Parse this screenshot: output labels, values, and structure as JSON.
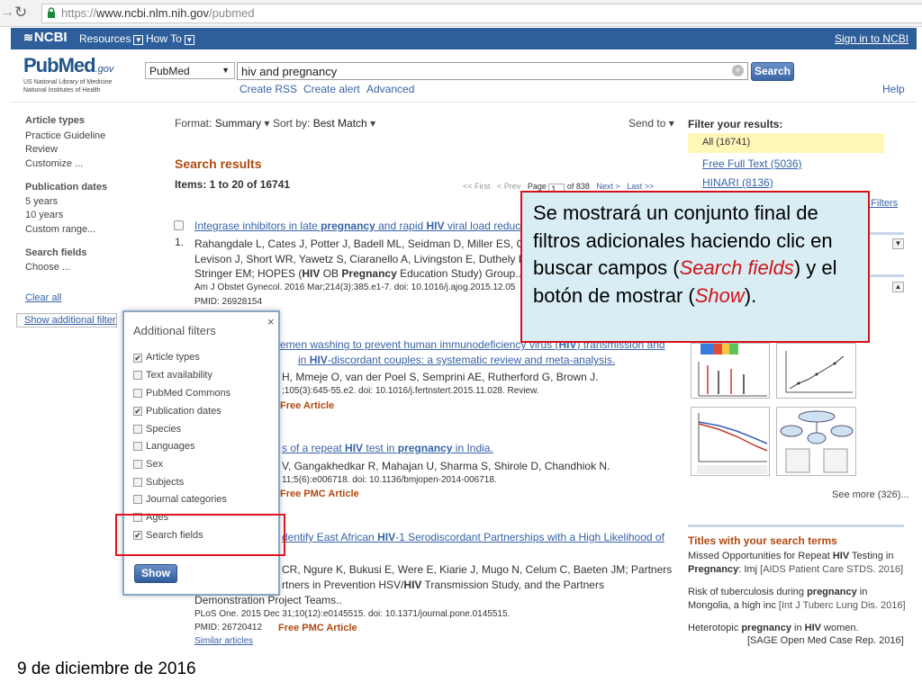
{
  "browser": {
    "url_scheme": "https://",
    "url_host": "www.ncbi.nlm.nih.gov",
    "url_path": "/pubmed"
  },
  "ncbi_bar": {
    "logo": "NCBI",
    "resources": "Resources",
    "howto": "How To",
    "signin": "Sign in to NCBI"
  },
  "header": {
    "logo_pub": "Pub",
    "logo_med": "Med",
    "logo_gov": ".gov",
    "nlm_line1": "US National Library of Medicine",
    "nlm_line2": "National Institutes of Health",
    "db_select": "PubMed",
    "search_value": "hiv and pregnancy",
    "search_button": "Search",
    "create_rss": "Create RSS",
    "create_alert": "Create alert",
    "advanced": "Advanced",
    "help": "Help"
  },
  "sidebar": {
    "article_types_head": "Article types",
    "article_types": [
      "Practice Guideline",
      "Review",
      "Customize ..."
    ],
    "pub_dates_head": "Publication dates",
    "pub_dates": [
      "5 years",
      "10 years",
      "Custom range..."
    ],
    "search_fields_head": "Search fields",
    "choose": "Choose ...",
    "clear_all": "Clear all",
    "show_additional": "Show additional filters"
  },
  "toolbar": {
    "format_label": "Format:",
    "format_value": "Summary",
    "sort_label": "Sort by:",
    "sort_value": "Best Match",
    "send_to": "Send to"
  },
  "results": {
    "heading": "Search results",
    "items_label": "Items: 1 to 20 of 16741",
    "pager_first": "<< First",
    "pager_prev": "< Prev",
    "pager_page": "Page",
    "pager_page_value": "1",
    "pager_of": "of 838",
    "pager_next": "Next >",
    "pager_last": "Last >>",
    "r1_num": "1.",
    "r1_title_a": "Integrase inhibitors in late ",
    "r1_title_b": "pregnancy",
    "r1_title_c": " and rapid ",
    "r1_title_d": "HIV",
    "r1_title_e": " viral load reduc",
    "r1_authors1": "Rahangdale L, Cates J, Potter J, Badell ML, Seidman D, Miller ES, C",
    "r1_authors2": "Levison J, Short WR, Yawetz S, Ciaranello A, Livingston E, Duthely L",
    "r1_authors3_a": "Stringer EM; HOPES (",
    "r1_authors3_b": "HIV",
    "r1_authors3_c": " OB ",
    "r1_authors3_d": "Pregnancy",
    "r1_authors3_e": " Education Study) Group...",
    "r1_journal": "Am J Obstet Gynecol. 2016 Mar;214(3):385.e1-7. doi: 10.1016/j.ajog.2015.12.05",
    "r1_pmid": "PMID: 26928154",
    "r2_title_a": "emen washing to prevent human immunodeficiency virus (",
    "r2_title_b": "HIV",
    "r2_title_c": ") transmission and",
    "r2_title2_a": "in ",
    "r2_title2_b": "HIV",
    "r2_title2_c": "-discordant couples: a systematic review and meta-analysis.",
    "r2_authors": "H, Mmeje O, van der Poel S, Semprini AE, Rutherford G, Brown J.",
    "r2_journal": ";105(3):645-55.e2. doi: 10.1016/j.fertnstert.2015.11.028. Review.",
    "r2_free": "Free Article",
    "r3_title_a": "s of a repeat ",
    "r3_title_b": "HIV",
    "r3_title_c": " test in ",
    "r3_title_d": "pregnancy",
    "r3_title_e": " in India.",
    "r3_authors": "V, Gangakhedkar R, Mahajan U, Sharma S, Shirole D, Chandhiok N.",
    "r3_journal": "11;5(6):e006718. doi: 10.1136/bmjopen-2014-006718.",
    "r3_free": "Free PMC Article",
    "r4_title_a": "dentify East African ",
    "r4_title_b": "HIV",
    "r4_title_c": "-1 Serodiscordant Partnerships with a High Likelihood of",
    "r4_authors1": "CR, Ngure K, Bukusi E, Were E, Kiarie J, Mugo N, Celum C, Baeten JM; Partners",
    "r4_authors2_a": "rtners in Prevention HSV/",
    "r4_authors2_b": "HIV",
    "r4_authors2_c": " Transmission Study, and the Partners",
    "r4_authors3": "Demonstration Project Teams..",
    "r4_journal": "PLoS One. 2015 Dec 31;10(12):e0145515. doi: 10.1371/journal.pone.0145515.",
    "r4_pmid": "PMID: 26720412",
    "r4_free": "Free PMC Article",
    "r4_similar": "Similar articles"
  },
  "right": {
    "filter_head": "Filter your results:",
    "filter_all": "All (16741)",
    "free_full_text": "Free Full Text (5036)",
    "hinari": "HINARI (8136)",
    "manage_filters": "e Filters",
    "see_more": "See more (326)...",
    "titles_head": "Titles with your search terms",
    "t1_a": "Missed Opportunities for Repeat ",
    "t1_b": "HIV",
    "t1_c": " Testing in",
    "t1_d": "Pregnancy",
    "t1_e": ": Imj",
    "t1_j": "[AIDS Patient Care STDS. 2016]",
    "t2_a": "Risk of tuberculosis during ",
    "t2_b": "pregnancy",
    "t2_c": " in",
    "t2_d": "Mongolia, a high inc",
    "t2_j": "[Int J Tuberc Lung Dis. 2016]",
    "t3_a": "Heterotopic ",
    "t3_b": "pregnancy",
    "t3_c": " in ",
    "t3_d": "HIV",
    "t3_e": " women.",
    "t3_j": "[SAGE Open Med Case Rep. 2016]"
  },
  "popup": {
    "title": "Additional filters",
    "close": "×",
    "items": [
      {
        "label": "Article types",
        "checked": "✔"
      },
      {
        "label": "Text availability",
        "checked": ""
      },
      {
        "label": "PubMed Commons",
        "checked": ""
      },
      {
        "label": "Publication dates",
        "checked": "✔"
      },
      {
        "label": "Species",
        "checked": ""
      },
      {
        "label": "Languages",
        "checked": ""
      },
      {
        "label": "Sex",
        "checked": ""
      },
      {
        "label": "Subjects",
        "checked": ""
      },
      {
        "label": "Journal categories",
        "checked": ""
      },
      {
        "label": "Ages",
        "checked": ""
      },
      {
        "label": "Search fields",
        "checked": "✔"
      }
    ],
    "show_button": "Show"
  },
  "callout": {
    "text_a": "Se mostrará un conjunto final de filtros adicionales haciendo clic en buscar campos (",
    "text_b": "Search fields",
    "text_c": ") y el botón de mostrar (",
    "text_d": "Show",
    "text_e": ")."
  },
  "footer": {
    "date": "9 de diciembre de 2016"
  },
  "colors": {
    "ncbi_blue": "#2f5f9a",
    "link_blue": "#3763a8",
    "accent_orange": "#b04a10",
    "callout_bg": "#d9eef4",
    "highlight_red": "#d7101a"
  }
}
